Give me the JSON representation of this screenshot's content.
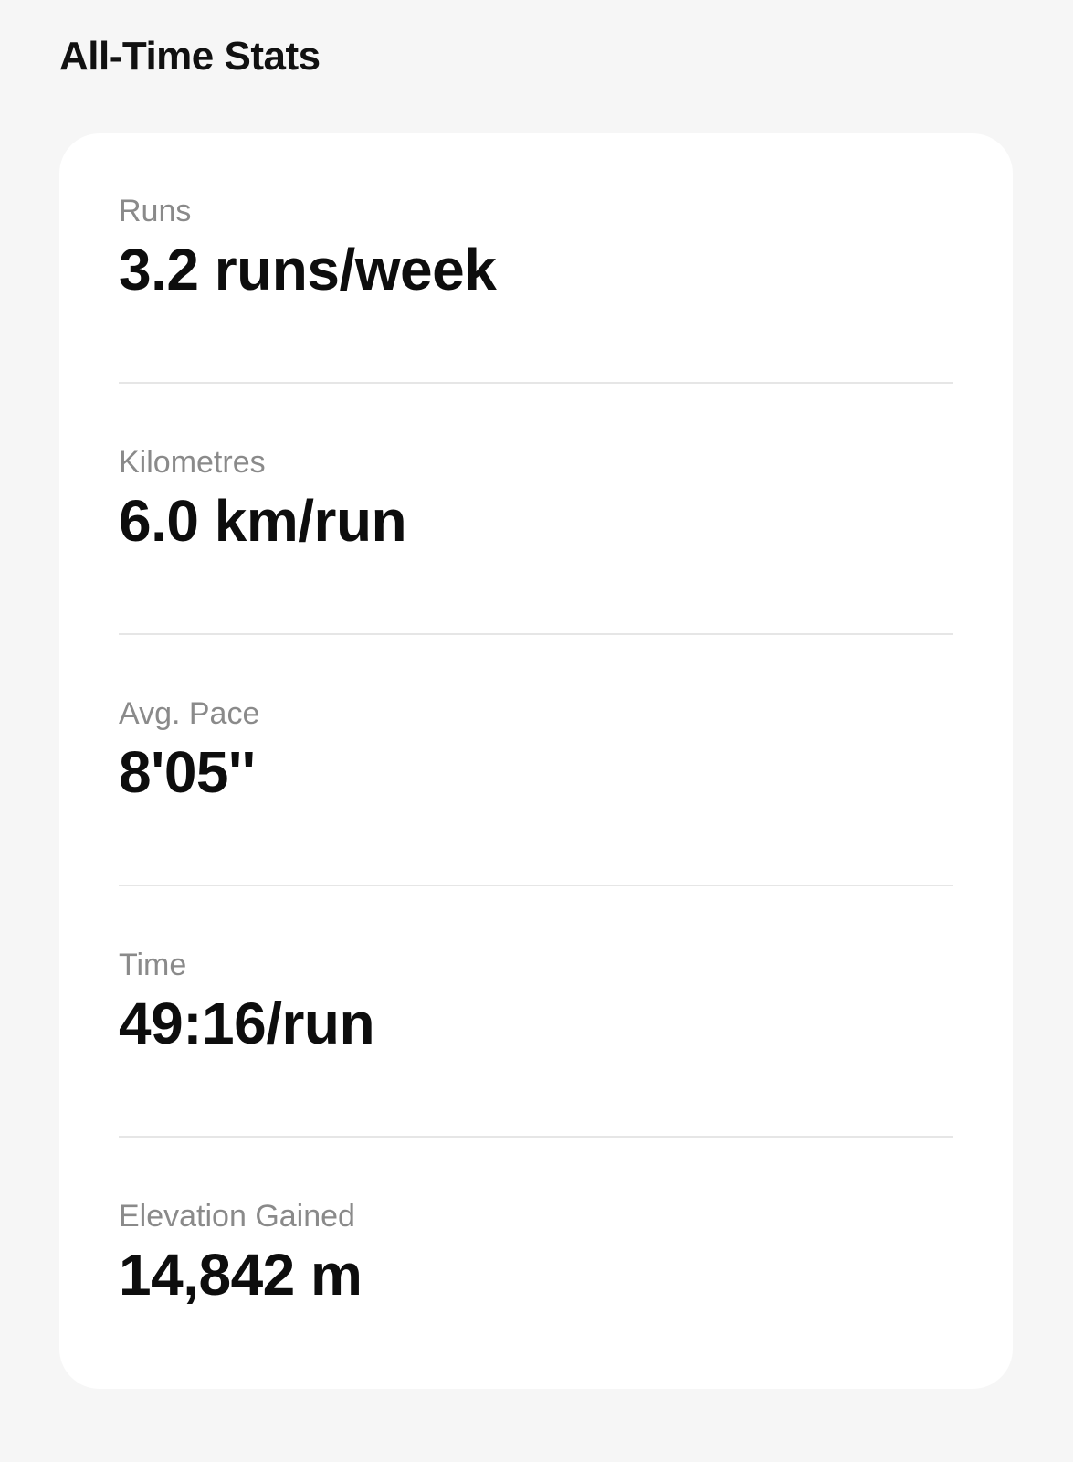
{
  "header": {
    "title": "All-Time Stats"
  },
  "stats": [
    {
      "label": "Runs",
      "value": "3.2 runs/week"
    },
    {
      "label": "Kilometres",
      "value": "6.0 km/run"
    },
    {
      "label": "Avg. Pace",
      "value": "8'05''"
    },
    {
      "label": "Time",
      "value": "49:16/run"
    },
    {
      "label": "Elevation Gained",
      "value": "14,842 m"
    }
  ],
  "colors": {
    "background": "#f6f6f6",
    "card": "#ffffff",
    "label": "#8a8a8a",
    "value": "#0d0d0d",
    "divider": "#e6e6e6"
  }
}
